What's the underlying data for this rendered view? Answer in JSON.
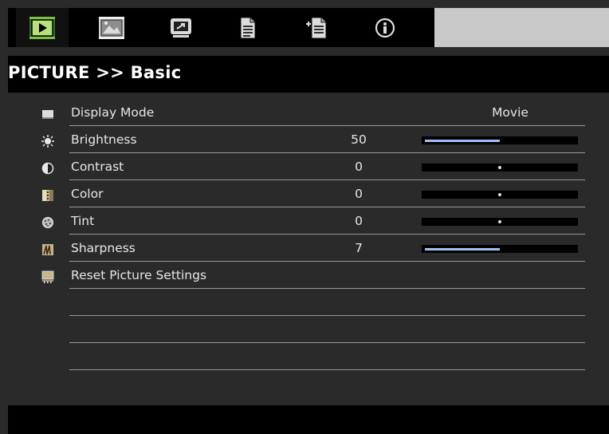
{
  "tabs": [
    {
      "icon": "picture-icon",
      "active": true
    },
    {
      "icon": "screen-icon",
      "active": false
    },
    {
      "icon": "setting-icon",
      "active": false
    },
    {
      "icon": "volume-document-icon",
      "active": false
    },
    {
      "icon": "options-document-icon",
      "active": false
    },
    {
      "icon": "info-icon",
      "active": false
    }
  ],
  "title": "PICTURE >> Basic",
  "menu": [
    {
      "label": "Display Mode",
      "icon": "display-mode-icon",
      "value": "Movie"
    },
    {
      "label": "Brightness",
      "icon": "brightness-icon",
      "value": "50",
      "level": 0.5
    },
    {
      "label": "Contrast",
      "icon": "contrast-icon",
      "value": "0",
      "level": 0.5
    },
    {
      "label": "Color",
      "icon": "color-icon",
      "value": "0",
      "level": 0.5
    },
    {
      "label": "Tint",
      "icon": "tint-icon",
      "value": "0",
      "level": 0.5
    },
    {
      "label": "Sharpness",
      "icon": "sharpness-icon",
      "value": "7",
      "level": 0.5
    },
    {
      "label": "Reset Picture Settings",
      "icon": "reset-icon"
    }
  ],
  "colors": {
    "accent": "#9fc3f5",
    "background": "#2a2a2a",
    "bar": "#000000"
  }
}
